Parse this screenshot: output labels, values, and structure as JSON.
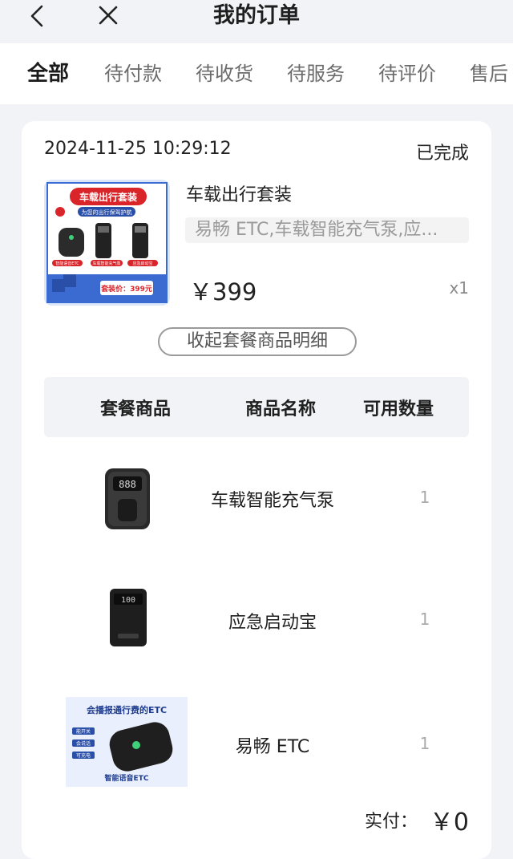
{
  "header": {
    "title": "我的订单"
  },
  "tabs": [
    {
      "label": "全部",
      "active": true
    },
    {
      "label": "待付款"
    },
    {
      "label": "待收货"
    },
    {
      "label": "待服务"
    },
    {
      "label": "待评价"
    },
    {
      "label": "售后"
    }
  ],
  "order": {
    "datetime": "2024-11-25 10:29:12",
    "status": "已完成",
    "product_title": "车载出行套装",
    "product_desc": "易畅 ETC,车载智能充气泵,应...",
    "price": "￥399",
    "quantity": "x1",
    "thumb": {
      "headline": "车载出行套装",
      "subline": "为您的出行保驾护航",
      "captions": [
        "智能语音ETC",
        "车载智能充气泵",
        "应急启动宝"
      ],
      "price_badge": "套装价：399元"
    },
    "collapse_label": "收起套餐商品明细",
    "table": {
      "headers": [
        "套餐商品",
        "商品名称",
        "可用数量"
      ],
      "rows": [
        {
          "name": "车载智能充气泵",
          "qty": "1",
          "image": "pump-device"
        },
        {
          "name": "应急启动宝",
          "qty": "1",
          "image": "jump-starter-device"
        },
        {
          "name": "易畅 ETC",
          "qty": "1",
          "image": "etc-device",
          "image_text": {
            "headline": "会播报通行费的ETC",
            "tags": [
              "能开关",
              "会说话",
              "可充电"
            ],
            "footer": "智能语音ETC"
          }
        }
      ]
    },
    "paid_label": "实付：",
    "paid_value": "￥0"
  },
  "colors": {
    "background": "#f2f3f7",
    "card": "#ffffff",
    "thumb_red": "#d9252a",
    "thumb_blue": "#2a4fa8"
  }
}
